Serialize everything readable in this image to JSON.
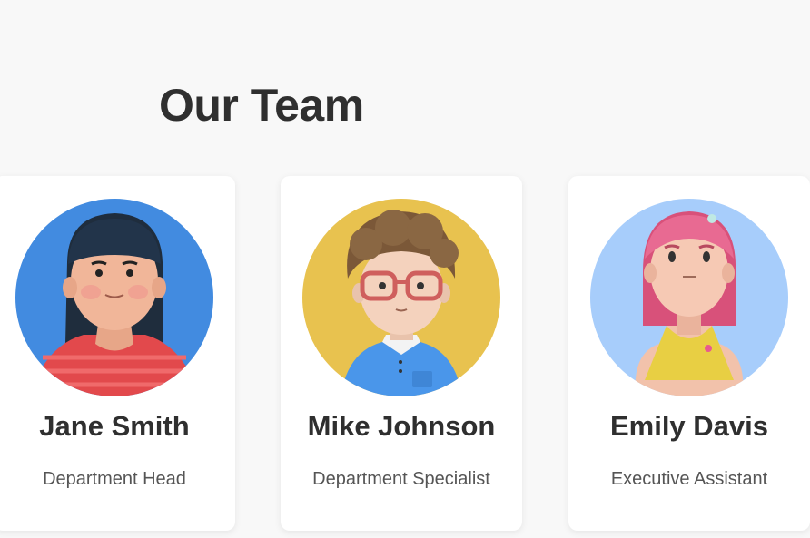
{
  "section": {
    "title": "Our Team"
  },
  "team": [
    {
      "name": "Jane Smith",
      "role": "Department Head",
      "avatar_bg": "#428be0"
    },
    {
      "name": "Mike Johnson",
      "role": "Department Specialist",
      "avatar_bg": "#e8c24f"
    },
    {
      "name": "Emily Davis",
      "role": "Executive Assistant",
      "avatar_bg": "#a7cdfb"
    }
  ]
}
